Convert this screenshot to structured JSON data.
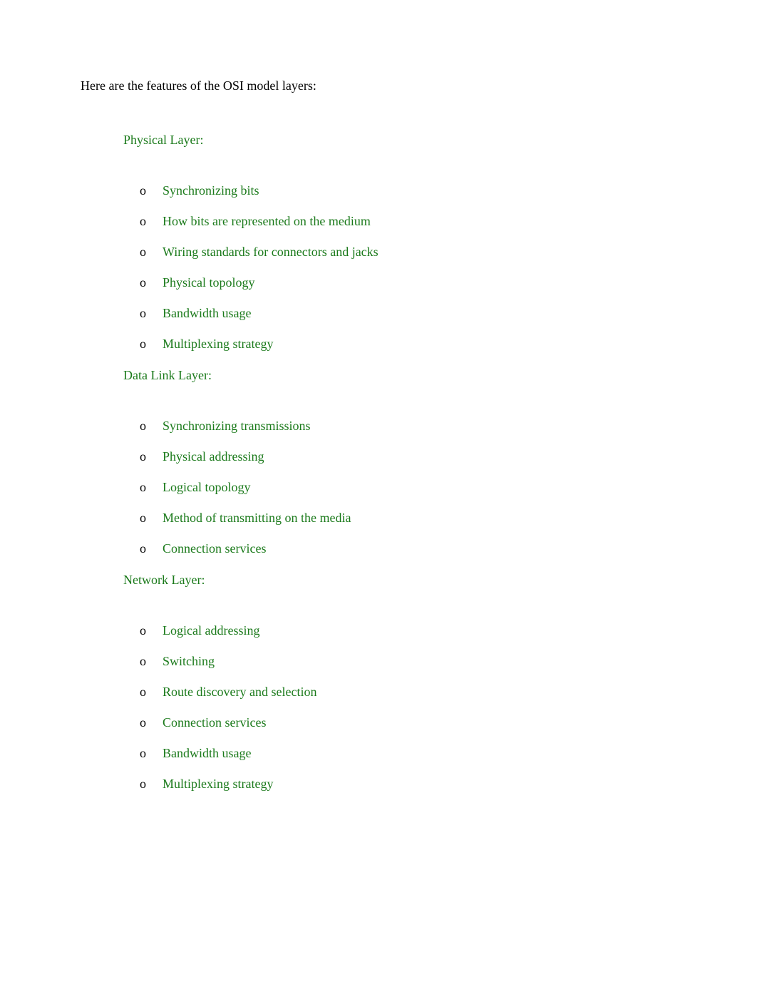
{
  "intro": "Here are the features of the OSI model layers:",
  "layers": [
    {
      "bullet": "",
      "title": "Physical Layer:",
      "features": [
        {
          "bullet": "o",
          "text": "Synchronizing bits"
        },
        {
          "bullet": "o",
          "text": "How bits are represented on the medium"
        },
        {
          "bullet": "o",
          "text": "Wiring standards for connectors and jacks"
        },
        {
          "bullet": "o",
          "text": "Physical topology"
        },
        {
          "bullet": "o",
          "text": "Bandwidth usage"
        },
        {
          "bullet": "o",
          "text": "Multiplexing strategy"
        }
      ]
    },
    {
      "bullet": "",
      "title": "Data Link Layer:",
      "features": [
        {
          "bullet": "o",
          "text": "Synchronizing transmissions"
        },
        {
          "bullet": "o",
          "text": "Physical addressing"
        },
        {
          "bullet": "o",
          "text": "Logical topology"
        },
        {
          "bullet": "o",
          "text": "Method of transmitting on the media"
        },
        {
          "bullet": "o",
          "text": "Connection services"
        }
      ]
    },
    {
      "bullet": "",
      "title": "Network Layer:",
      "features": [
        {
          "bullet": "o",
          "text": "Logical addressing"
        },
        {
          "bullet": "o",
          "text": "Switching"
        },
        {
          "bullet": "o",
          "text": "Route discovery and selection"
        },
        {
          "bullet": "o",
          "text": "Connection services"
        },
        {
          "bullet": "o",
          "text": "Bandwidth usage"
        },
        {
          "bullet": "o",
          "text": "Multiplexing strategy"
        }
      ]
    }
  ]
}
